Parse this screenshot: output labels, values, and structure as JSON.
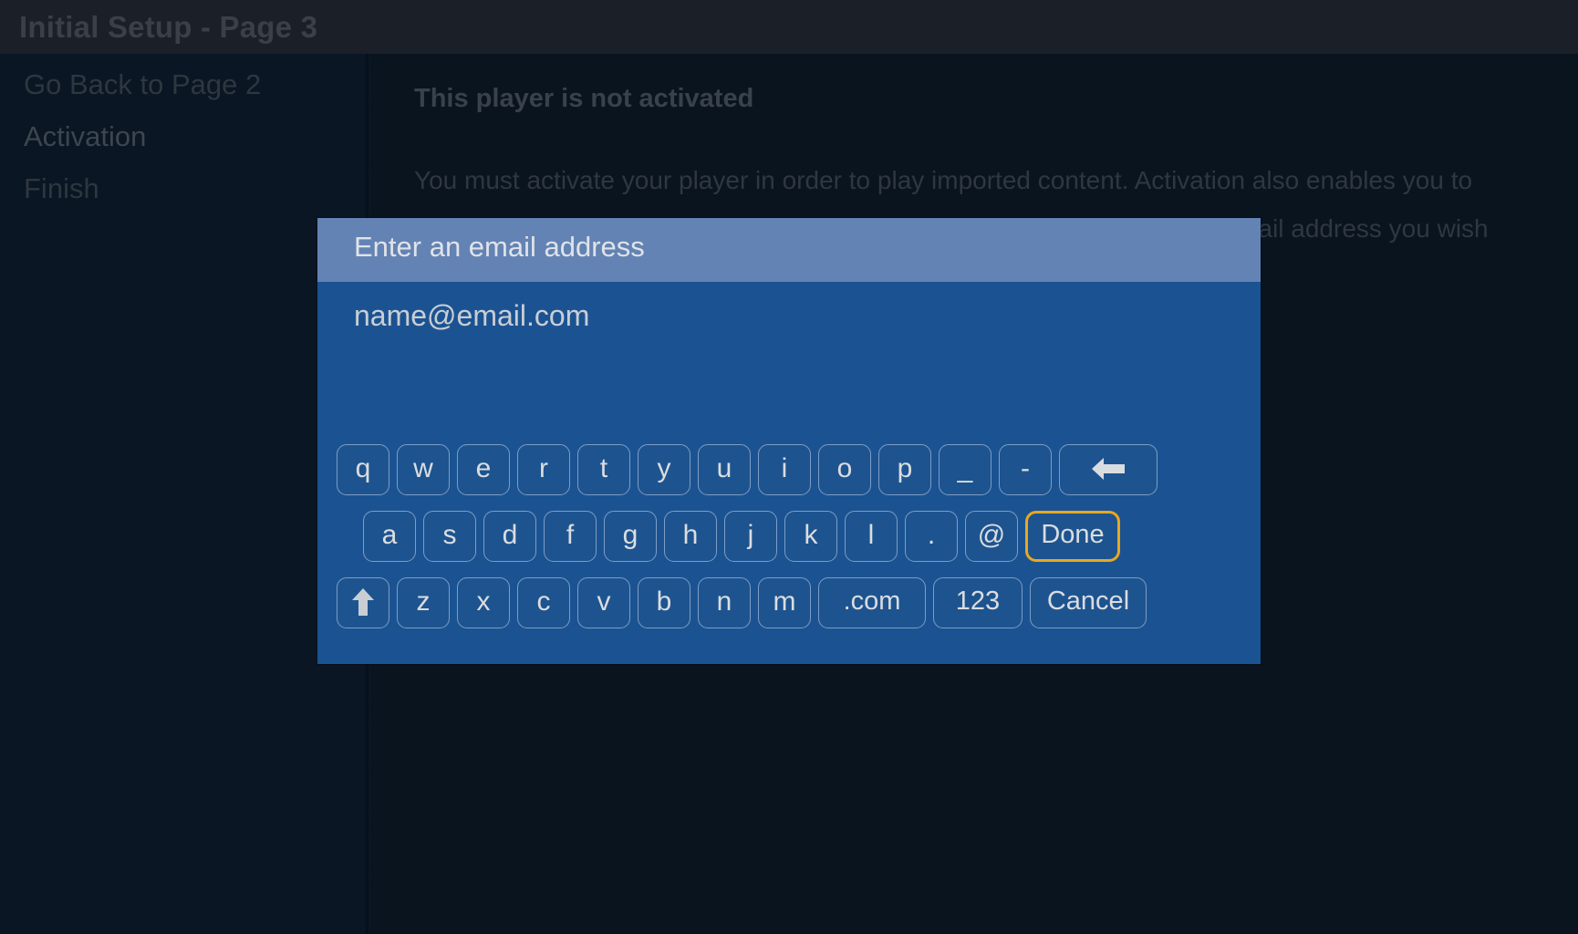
{
  "window": {
    "title": "Initial Setup - Page 3"
  },
  "sidebar": {
    "items": [
      {
        "label": "Go Back to Page 2",
        "active": false
      },
      {
        "label": "Activation",
        "active": true
      },
      {
        "label": "Finish",
        "active": false
      }
    ]
  },
  "main": {
    "heading": "This player is not activated",
    "body": "You must activate your player in order to play imported content.  Activation also enables you to purchase and download movies in full DVD or Blu-ray quality.  Enter the email address you wish to use to begin the activation process."
  },
  "dialog": {
    "title": "Enter an email address",
    "input_value": "name@email.com",
    "input_placeholder": "name@email.com",
    "focused_key": "Done",
    "focus_color": "#e8a81f",
    "header_color": "#6383b4",
    "body_color": "#1b5392",
    "key_fill_color": "#1d548f",
    "key_border_color": "#7e9cc4",
    "keyboard": {
      "row1": [
        {
          "label": "q",
          "name": "key-q",
          "type": "char"
        },
        {
          "label": "w",
          "name": "key-w",
          "type": "char"
        },
        {
          "label": "e",
          "name": "key-e",
          "type": "char"
        },
        {
          "label": "r",
          "name": "key-r",
          "type": "char"
        },
        {
          "label": "t",
          "name": "key-t",
          "type": "char"
        },
        {
          "label": "y",
          "name": "key-y",
          "type": "char"
        },
        {
          "label": "u",
          "name": "key-u",
          "type": "char"
        },
        {
          "label": "i",
          "name": "key-i",
          "type": "char"
        },
        {
          "label": "o",
          "name": "key-o",
          "type": "char"
        },
        {
          "label": "p",
          "name": "key-p",
          "type": "char"
        },
        {
          "label": "_",
          "name": "key-underscore",
          "type": "char"
        },
        {
          "label": "-",
          "name": "key-hyphen",
          "type": "char"
        },
        {
          "label": "",
          "name": "backspace-icon",
          "type": "backspace"
        }
      ],
      "row2": [
        {
          "label": "a",
          "name": "key-a",
          "type": "char"
        },
        {
          "label": "s",
          "name": "key-s",
          "type": "char"
        },
        {
          "label": "d",
          "name": "key-d",
          "type": "char"
        },
        {
          "label": "f",
          "name": "key-f",
          "type": "char"
        },
        {
          "label": "g",
          "name": "key-g",
          "type": "char"
        },
        {
          "label": "h",
          "name": "key-h",
          "type": "char"
        },
        {
          "label": "j",
          "name": "key-j",
          "type": "char"
        },
        {
          "label": "k",
          "name": "key-k",
          "type": "char"
        },
        {
          "label": "l",
          "name": "key-l",
          "type": "char"
        },
        {
          "label": ".",
          "name": "key-period",
          "type": "char"
        },
        {
          "label": "@",
          "name": "key-at",
          "type": "char"
        },
        {
          "label": "Done",
          "name": "done-button",
          "type": "done"
        }
      ],
      "row3": [
        {
          "label": "",
          "name": "shift-icon",
          "type": "shift"
        },
        {
          "label": "z",
          "name": "key-z",
          "type": "char"
        },
        {
          "label": "x",
          "name": "key-x",
          "type": "char"
        },
        {
          "label": "c",
          "name": "key-c",
          "type": "char"
        },
        {
          "label": "v",
          "name": "key-v",
          "type": "char"
        },
        {
          "label": "b",
          "name": "key-b",
          "type": "char"
        },
        {
          "label": "n",
          "name": "key-n",
          "type": "char"
        },
        {
          "label": "m",
          "name": "key-m",
          "type": "char"
        },
        {
          "label": ".com",
          "name": "key-dotcom",
          "type": "dotcom"
        },
        {
          "label": "123",
          "name": "key-numbers",
          "type": "numbers"
        },
        {
          "label": "Cancel",
          "name": "cancel-button",
          "type": "cancel"
        }
      ]
    }
  }
}
